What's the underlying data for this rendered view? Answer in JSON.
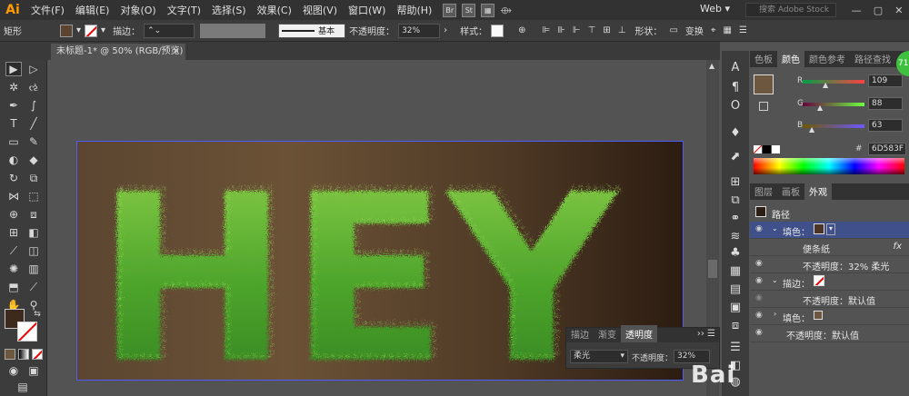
{
  "app": {
    "logo": "Ai"
  },
  "menu": [
    "文件(F)",
    "编辑(E)",
    "对象(O)",
    "文字(T)",
    "选择(S)",
    "效果(C)",
    "视图(V)",
    "窗口(W)",
    "帮助(H)"
  ],
  "menu_badges": [
    "Br",
    "St"
  ],
  "workspace": "Web",
  "adobe_stock_placeholder": "搜索 Adobe Stock",
  "control_bar": {
    "object_type": "矩形",
    "stroke_label": "描边：",
    "stroke_style": "基本",
    "opacity_label": "不透明度：",
    "opacity_value": "32%",
    "style_label": "样式：",
    "shape_label": "形状：",
    "transform_label": "变换"
  },
  "document_tab": {
    "title": "未标题-1* @ 50% (RGB/预览)",
    "close": "×"
  },
  "artwork": {
    "text": "HEY"
  },
  "color_panel": {
    "tabs": [
      "色板",
      "颜色",
      "颜色参考",
      "路径查找"
    ],
    "active_tab": "颜色",
    "r_label": "R",
    "r_value": "109",
    "g_label": "G",
    "g_value": "88",
    "b_label": "B",
    "b_value": "63",
    "hex_prefix": "#",
    "hex_value": "6D583F",
    "swatch_color": "#6d583f"
  },
  "appearance_panel": {
    "tabs": [
      "图层",
      "画板",
      "外观"
    ],
    "active_tab": "外观",
    "path_label": "路径",
    "rows": [
      {
        "label": "填色：",
        "kind": "fill"
      },
      {
        "label": "便条纸",
        "kind": "effect"
      },
      {
        "label": "不透明度：32% 柔光",
        "kind": "opacity"
      },
      {
        "label": "描边：",
        "kind": "stroke"
      },
      {
        "label": "不透明度：默认值",
        "kind": "opacity"
      },
      {
        "label": "填色：",
        "kind": "fill2"
      },
      {
        "label": "不透明度：默认值",
        "kind": "opacity"
      }
    ],
    "fx_label": "fx"
  },
  "transparency_panel": {
    "tabs": [
      "描边",
      "渐变",
      "透明度"
    ],
    "active_tab": "透明度",
    "blend_mode": "柔光",
    "opacity_label": "不透明度：",
    "opacity_value": "32%"
  },
  "avatar_text": "71",
  "watermark": "Bai"
}
